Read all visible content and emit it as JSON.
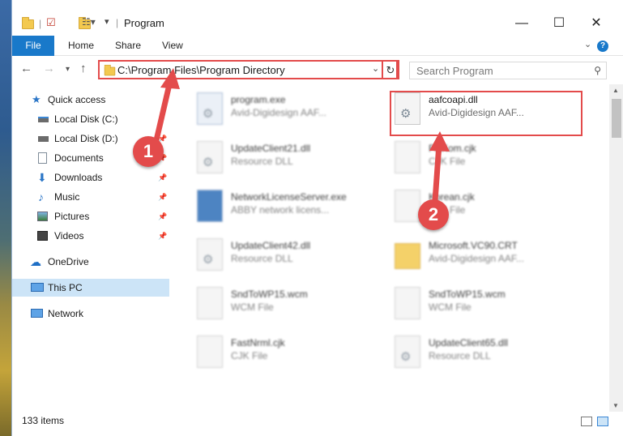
{
  "window": {
    "title": "Program",
    "minimize": "—",
    "maximize": "☐",
    "close": "✕"
  },
  "ribbon": {
    "file": "File",
    "home": "Home",
    "share": "Share",
    "view": "View"
  },
  "nav": {
    "address": "C:\\Program Files\\Program Directory",
    "search_placeholder": "Search Program"
  },
  "sidebar": {
    "items": [
      {
        "label": "Quick access",
        "icon": "star-icon"
      },
      {
        "label": "Local Disk (C:)",
        "icon": "drive-icon"
      },
      {
        "label": "Local Disk (D:)",
        "icon": "drive-icon"
      },
      {
        "label": "Documents",
        "icon": "documents-icon"
      },
      {
        "label": "Downloads",
        "icon": "download-icon"
      },
      {
        "label": "Music",
        "icon": "music-icon"
      },
      {
        "label": "Pictures",
        "icon": "pictures-icon"
      },
      {
        "label": "Videos",
        "icon": "videos-icon"
      },
      {
        "label": "OneDrive",
        "icon": "cloud-icon"
      },
      {
        "label": "This PC",
        "icon": "computer-icon"
      },
      {
        "label": "Network",
        "icon": "network-icon"
      }
    ]
  },
  "files": [
    {
      "name": "program.exe",
      "type": "Avid-Digidesign AAF...",
      "icon": "app-icon"
    },
    {
      "name": "aafcoapi.dll",
      "type": "Avid-Digidesign AAF...",
      "icon": "dll-icon"
    },
    {
      "name": "UpdateClient21.dll",
      "type": "Resource DLL",
      "icon": "dll-icon"
    },
    {
      "name": "FRKom.cjk",
      "type": "CJK File",
      "icon": "file-icon"
    },
    {
      "name": "NetworkLicenseServer.exe",
      "type": "ABBY network licens...",
      "icon": "app-icon"
    },
    {
      "name": "Korean.cjk",
      "type": "CJK File",
      "icon": "file-icon"
    },
    {
      "name": "UpdateClient42.dll",
      "type": "Resource DLL",
      "icon": "dll-icon"
    },
    {
      "name": "Microsoft.VC90.CRT",
      "type": "Avid-Digidesign AAF...",
      "icon": "folder-icon"
    },
    {
      "name": "SndToWP15.wcm",
      "type": "WCM File",
      "icon": "file-icon"
    },
    {
      "name": "SndToWP15.wcm",
      "type": "WCM File",
      "icon": "file-icon"
    },
    {
      "name": "FastNrml.cjk",
      "type": "CJK File",
      "icon": "file-icon"
    },
    {
      "name": "UpdateClient65.dll",
      "type": "Resource DLL",
      "icon": "dll-icon"
    }
  ],
  "status": {
    "count": "133 items"
  },
  "annotations": {
    "step1": "1",
    "step2": "2",
    "color": "#e34b4b"
  }
}
